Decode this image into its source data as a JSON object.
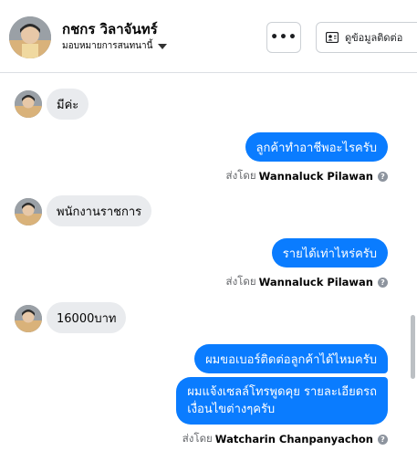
{
  "header": {
    "contact_name": "กชกร วิลาจันทร์",
    "assign_label": "มอบหมายการสนทนานี้",
    "more_label": "•••",
    "view_contact_label": "ดูข้อมูลติดต่อ"
  },
  "messages": [
    {
      "direction": "in",
      "text": "มีค่ะ"
    },
    {
      "direction": "out",
      "text": "ลูกค้าทำอาชีพอะไรครับ",
      "sent_by_prefix": "ส่งโดย",
      "sender": "Wannaluck Pilawan"
    },
    {
      "direction": "in",
      "text": "พนักงานราชการ"
    },
    {
      "direction": "out",
      "text": "รายได้เท่าไหร่ครับ",
      "sent_by_prefix": "ส่งโดย",
      "sender": "Wannaluck Pilawan"
    },
    {
      "direction": "in",
      "text": "16000บาท"
    },
    {
      "direction": "out",
      "text": "ผมขอเบอร์ติดต่อลูกค้าได้ไหมครับ"
    },
    {
      "direction": "out",
      "lines": [
        "ผมแจ้งเซลล์โทรพูดคุย รายละเอียดรถ",
        "เงื่อนไขต่างๆครับ"
      ],
      "sent_by_prefix": "ส่งโดย",
      "sender": "Watcharin Chanpanyachon"
    }
  ],
  "colors": {
    "outgoing_bubble": "#0a7cff",
    "incoming_bubble": "#e9ebee"
  }
}
